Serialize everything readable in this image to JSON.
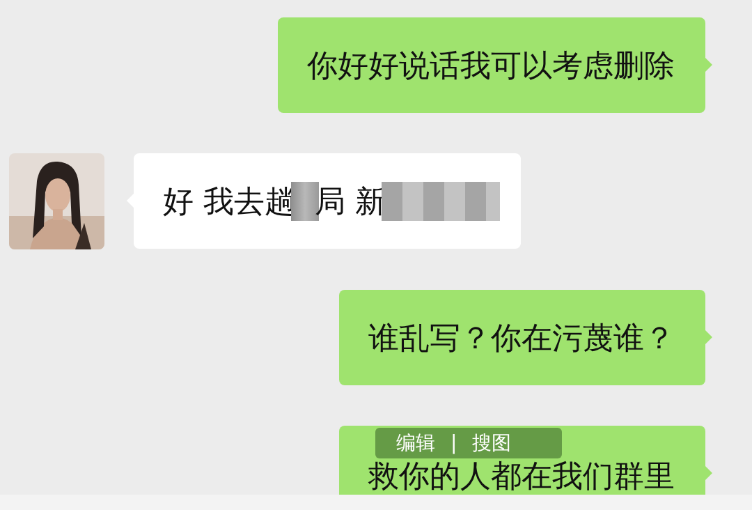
{
  "messages": [
    {
      "kind": "sent",
      "segments": [
        {
          "kind": "text",
          "text": "你好好说话我可以考虑删除"
        }
      ]
    },
    {
      "kind": "received",
      "segments": [
        {
          "kind": "text",
          "text": "好 我去趟"
        },
        {
          "kind": "blur"
        },
        {
          "kind": "text",
          "text": "局 新"
        },
        {
          "kind": "blur"
        }
      ]
    },
    {
      "kind": "sent",
      "segments": [
        {
          "kind": "text",
          "text": "谁乱写？你在污蔑谁？"
        }
      ]
    },
    {
      "kind": "sent",
      "segments": [
        {
          "kind": "text",
          "text": "救你的人都在我们群里"
        }
      ],
      "toolbar": [
        "编辑",
        "|",
        "搜图"
      ]
    }
  ]
}
